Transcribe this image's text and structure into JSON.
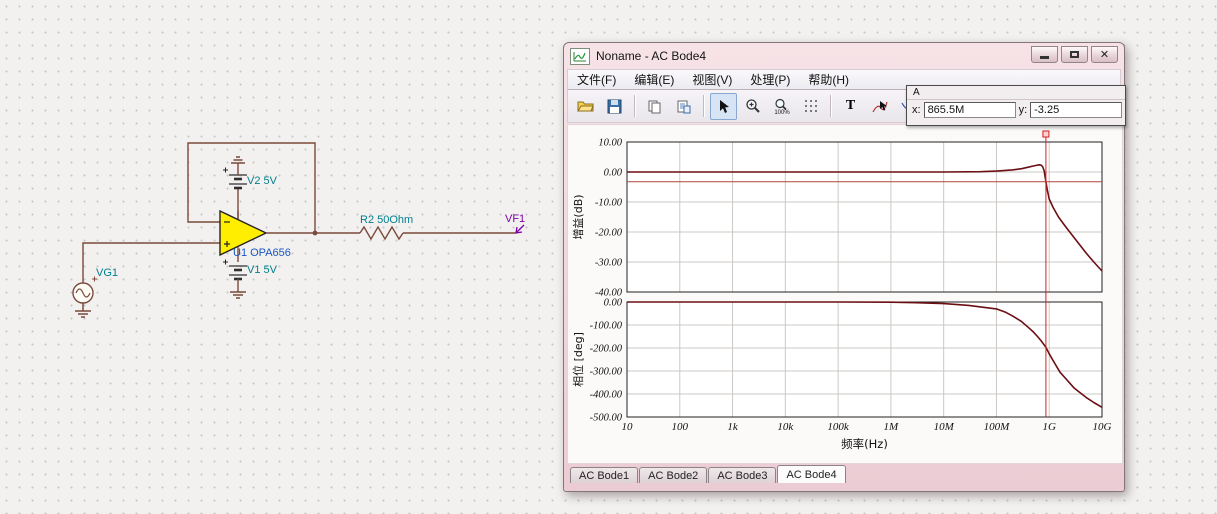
{
  "schematic": {
    "labels": {
      "vg1": "VG1",
      "v2": "V2 5V",
      "v1": "V1 5V",
      "u1": "U1 OPA656",
      "r2": "R2 50Ohm",
      "vf1": "VF1"
    },
    "colors": {
      "wire": "#7b4a3c",
      "component_label": "#007f8c",
      "probe_label": "#7d00a8",
      "opamp_fill": "#ffee00"
    }
  },
  "window": {
    "title": "Noname - AC Bode4",
    "menu": [
      {
        "label": "文件(F)"
      },
      {
        "label": "编辑(E)"
      },
      {
        "label": "视图(V)"
      },
      {
        "label": "处理(P)"
      },
      {
        "label": "帮助(H)"
      }
    ],
    "toolbar": {
      "zoom_label": "100%",
      "text_tool_label": "T"
    },
    "cursor_panel": {
      "title": "A",
      "x_label": "x:",
      "x_value": "865.5M",
      "y_label": "y:",
      "y_value": "-3.25"
    },
    "tabs": [
      {
        "label": "AC Bode1",
        "active": false
      },
      {
        "label": "AC Bode2",
        "active": false
      },
      {
        "label": "AC Bode3",
        "active": false
      },
      {
        "label": "AC Bode4",
        "active": true
      }
    ]
  },
  "chart_data": [
    {
      "type": "line",
      "name": "gain",
      "ylabel": "增益(dB)",
      "ylim": [
        -40,
        10
      ],
      "yticks": [
        10,
        0,
        -10,
        -20,
        -30,
        -40
      ],
      "ytick_labels": [
        "10.00",
        "0.00",
        "-10.00",
        "-20.00",
        "-30.00",
        "-40.00"
      ],
      "xlim": [
        10,
        10000000000
      ],
      "x_scale": "log",
      "grid": true,
      "line_color": "#6b0f14",
      "series": [
        {
          "name": "Gain",
          "x": [
            10,
            100,
            1000,
            10000,
            100000,
            1000000,
            10000000,
            50000000,
            100000000,
            200000000,
            300000000,
            400000000,
            500000000,
            600000000,
            650000000,
            700000000,
            750000000,
            800000000,
            865500000,
            920000000,
            1000000000,
            1200000000,
            1500000000,
            2000000000,
            3000000000,
            5000000000,
            7000000000,
            10000000000
          ],
          "y": [
            0,
            0,
            0,
            0,
            0,
            0,
            0,
            0.1,
            0.3,
            0.7,
            1.1,
            1.6,
            2.0,
            2.3,
            2.4,
            2.3,
            1.8,
            0.5,
            -3.25,
            -6,
            -9,
            -12,
            -15,
            -18,
            -22,
            -27,
            -30,
            -33
          ]
        }
      ],
      "cursor": {
        "label": "A",
        "x": 865500000,
        "y": -3.25,
        "color": "#d02020",
        "hline_color": "#b5433a"
      }
    },
    {
      "type": "line",
      "name": "phase",
      "ylabel": "相位 [deg]",
      "ylim": [
        -500,
        0
      ],
      "yticks": [
        0,
        -100,
        -200,
        -300,
        -400,
        -500
      ],
      "ytick_labels": [
        "0.00",
        "-100.00",
        "-200.00",
        "-300.00",
        "-400.00",
        "-500.00"
      ],
      "xlim": [
        10,
        10000000000
      ],
      "x_scale": "log",
      "grid": true,
      "line_color": "#6b0f14",
      "series": [
        {
          "name": "Phase",
          "x": [
            10,
            100,
            1000,
            10000,
            100000,
            1000000,
            3000000,
            10000000,
            30000000,
            100000000,
            150000000,
            200000000,
            300000000,
            400000000,
            500000000,
            600000000,
            700000000,
            865500000,
            1000000000,
            1300000000,
            1600000000,
            2000000000,
            3000000000,
            5000000000,
            7000000000,
            10000000000
          ],
          "y": [
            0,
            0,
            0,
            0,
            0,
            -1,
            -3,
            -7,
            -15,
            -30,
            -45,
            -60,
            -85,
            -110,
            -130,
            -150,
            -168,
            -197,
            -225,
            -270,
            -305,
            -330,
            -375,
            -415,
            -437,
            -458
          ]
        }
      ]
    }
  ],
  "x_axis": {
    "label": "频率(Hz)",
    "tick_labels": [
      "10",
      "100",
      "1k",
      "10k",
      "100k",
      "1M",
      "10M",
      "100M",
      "1G",
      "10G"
    ]
  }
}
